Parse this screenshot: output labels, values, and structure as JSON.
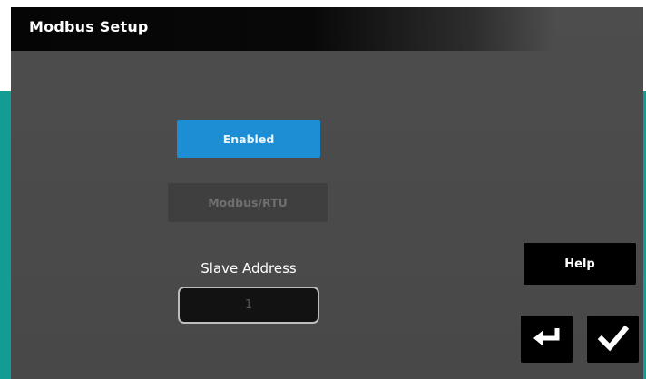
{
  "header": {
    "title": "Modbus Setup"
  },
  "modbus": {
    "state_button": "Enabled",
    "protocol_button": "Modbus/RTU",
    "slave_address_label": "Slave Address",
    "slave_address_value": "1"
  },
  "actions": {
    "help_label": "Help",
    "back_icon": "return-arrow-icon",
    "confirm_icon": "checkmark-icon"
  },
  "colors": {
    "accent_blue": "#1d8ed4",
    "screen_gray": "#4b4b4b",
    "frame_teal": "#139c93"
  }
}
